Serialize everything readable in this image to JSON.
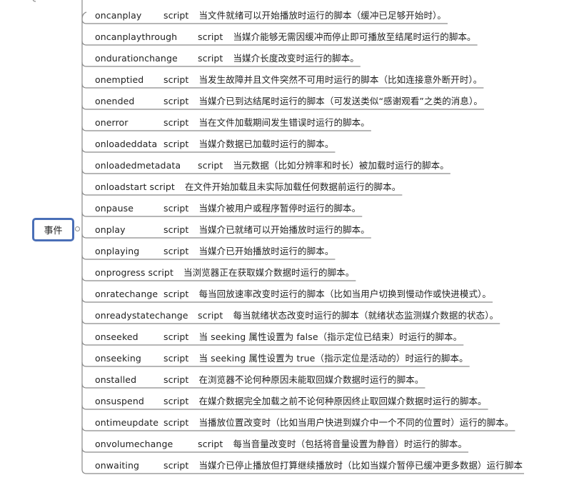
{
  "center_topic": "事件",
  "topics": [
    {
      "event": "oncanplay",
      "kind": "script",
      "desc": "当文件就绪可以开始播放时运行的脚本（缓冲已足够开始时）。"
    },
    {
      "event": "oncanplaythrough",
      "kind": "script",
      "desc": "当媒介能够无需因缓冲而停止即可播放至结尾时运行的脚本。"
    },
    {
      "event": "ondurationchange",
      "kind": "script",
      "desc": "当媒介长度改变时运行的脚本。"
    },
    {
      "event": "onemptied",
      "kind": "script",
      "desc": "当发生故障并且文件突然不可用时运行的脚本（比如连接意外断开时）。"
    },
    {
      "event": "onended",
      "kind": "script",
      "desc": "当媒介已到达结尾时运行的脚本（可发送类似“感谢观看”之类的消息）。"
    },
    {
      "event": "onerror",
      "kind": "script",
      "desc": "当在文件加载期间发生错误时运行的脚本。"
    },
    {
      "event": "onloadeddata",
      "kind": "script",
      "desc": "当媒介数据已加载时运行的脚本。"
    },
    {
      "event": "onloadedmetadata",
      "kind": "script",
      "desc": "当元数据（比如分辨率和时长）被加载时运行的脚本。"
    },
    {
      "event": "onloadstart",
      "kind": "script",
      "desc": "在文件开始加载且未实际加载任何数据前运行的脚本。"
    },
    {
      "event": "onpause",
      "kind": "script",
      "desc": "当媒介被用户或程序暂停时运行的脚本。"
    },
    {
      "event": "onplay",
      "kind": "script",
      "desc": "当媒介已就绪可以开始播放时运行的脚本。"
    },
    {
      "event": "onplaying",
      "kind": "script",
      "desc": "当媒介已开始播放时运行的脚本。"
    },
    {
      "event": "onprogress",
      "kind": "script",
      "desc": "当浏览器正在获取媒介数据时运行的脚本。"
    },
    {
      "event": "onratechange",
      "kind": "script",
      "desc": "每当回放速率改变时运行的脚本（比如当用户切换到慢动作或快进模式）。"
    },
    {
      "event": "onreadystatechange",
      "kind": "script",
      "desc": "每当就绪状态改变时运行的脚本（就绪状态监测媒介数据的状态）。"
    },
    {
      "event": "onseeked",
      "kind": "script",
      "desc": "当 seeking 属性设置为 false（指示定位已结束）时运行的脚本。"
    },
    {
      "event": "onseeking",
      "kind": "script",
      "desc": "当 seeking 属性设置为 true（指示定位是活动的）时运行的脚本。"
    },
    {
      "event": "onstalled",
      "kind": "script",
      "desc": "在浏览器不论何种原因未能取回媒介数据时运行的脚本。"
    },
    {
      "event": "onsuspend",
      "kind": "script",
      "desc": "在媒介数据完全加载之前不论何种原因终止取回媒介数据时运行的脚本。"
    },
    {
      "event": "ontimeupdate",
      "kind": "script",
      "desc": "当播放位置改变时（比如当用户快进到媒介中一个不同的位置时）运行的脚本。"
    },
    {
      "event": "onvolumechange",
      "kind": "script",
      "desc": "每当音量改变时（包括将音量设置为静音）时运行的脚本。"
    },
    {
      "event": "onwaiting",
      "kind": "script",
      "desc": "当媒介已停止播放但打算继续播放时（比如当媒介暂停已缓冲更多数据）运行脚本"
    }
  ]
}
